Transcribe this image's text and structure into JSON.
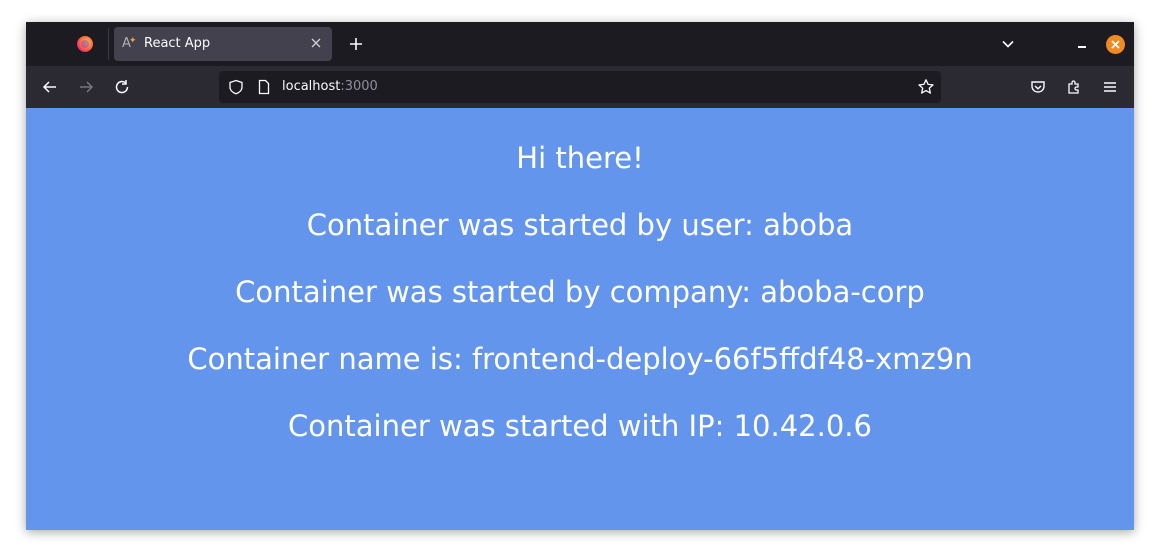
{
  "browser": {
    "tab": {
      "title": "React App",
      "favicon": "react-app-favicon"
    },
    "url": {
      "host": "localhost",
      "port": ":3000"
    },
    "icons": {
      "app": "firefox-logo-icon",
      "new_tab": "plus-icon",
      "list_tabs": "chevron-down-icon",
      "minimize": "minimize-icon",
      "close_window": "close-icon",
      "back": "back-arrow-icon",
      "forward": "forward-arrow-icon",
      "reload": "reload-icon",
      "tracking": "shield-icon",
      "page_info": "page-icon",
      "bookmark": "star-icon",
      "pocket": "pocket-icon",
      "extensions": "puzzle-icon",
      "menu": "hamburger-menu-icon"
    },
    "colors": {
      "tabstrip": "#1c1b22",
      "navbar": "#2b2a33",
      "close_button": "#f08a24"
    }
  },
  "page": {
    "background": "#6495ed",
    "greeting": "Hi there!",
    "user_line": "Container was started by user: aboba",
    "company_line": "Container was started by company: aboba-corp",
    "name_line": "Container name is: frontend-deploy-66f5ffdf48-xmz9n",
    "ip_line": "Container was started with IP: 10.42.0.6"
  }
}
